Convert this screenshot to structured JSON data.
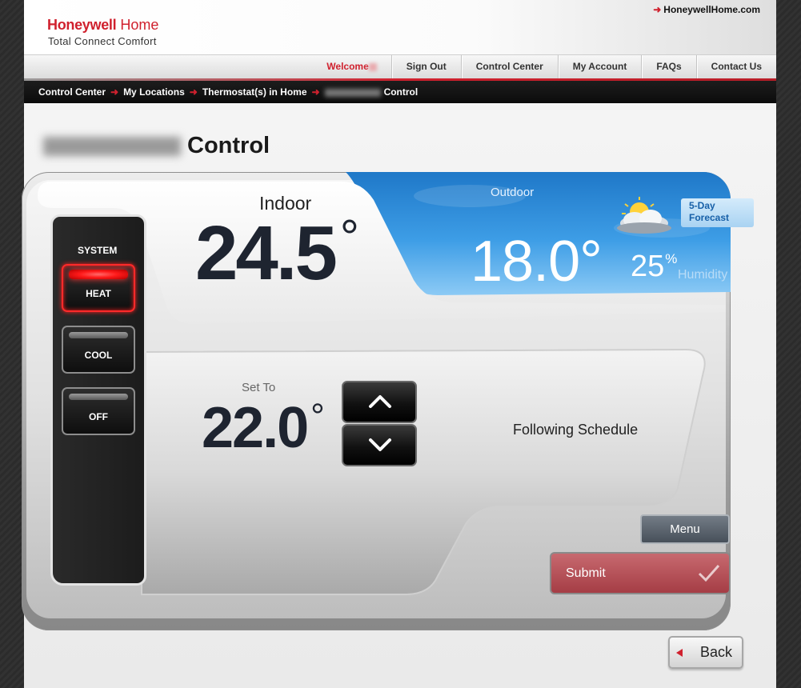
{
  "header": {
    "brand": "Honeywell",
    "brand_suffix": "Home",
    "tagline": "Total Connect Comfort",
    "site_link": "HoneywellHome.com"
  },
  "nav": {
    "welcome": "Welcome",
    "items": [
      "Sign Out",
      "Control Center",
      "My Account",
      "FAQs",
      "Contact Us"
    ]
  },
  "breadcrumb": {
    "items": [
      "Control Center",
      "My Locations",
      "Thermostat(s) in Home"
    ],
    "current": "Control"
  },
  "page": {
    "title": "Control"
  },
  "system": {
    "label": "SYSTEM",
    "modes": [
      "HEAT",
      "COOL",
      "OFF"
    ],
    "active_mode": "HEAT"
  },
  "indoor": {
    "label": "Indoor",
    "temp": "24.5",
    "deg": "°"
  },
  "outdoor": {
    "label": "Outdoor",
    "temp": "18.0°",
    "humidity": "25",
    "humidity_unit": "%",
    "humidity_label": "Humidity",
    "forecast_line1": "5-Day",
    "forecast_line2": "Forecast"
  },
  "setpoint": {
    "label": "Set To",
    "temp": "22.0",
    "deg": "°"
  },
  "status": "Following Schedule",
  "buttons": {
    "menu": "Menu",
    "submit": "Submit",
    "back": "Back"
  },
  "icons": [
    "arrow-right-icon",
    "weather-icon",
    "chevron-up-icon",
    "chevron-down-icon",
    "check-icon",
    "back-triangle-icon"
  ],
  "colors": {
    "brand_red": "#d0212e",
    "sky_blue": "#2b8fd9",
    "submit_red": "#b04a52",
    "heat_glow": "#ff2020"
  }
}
